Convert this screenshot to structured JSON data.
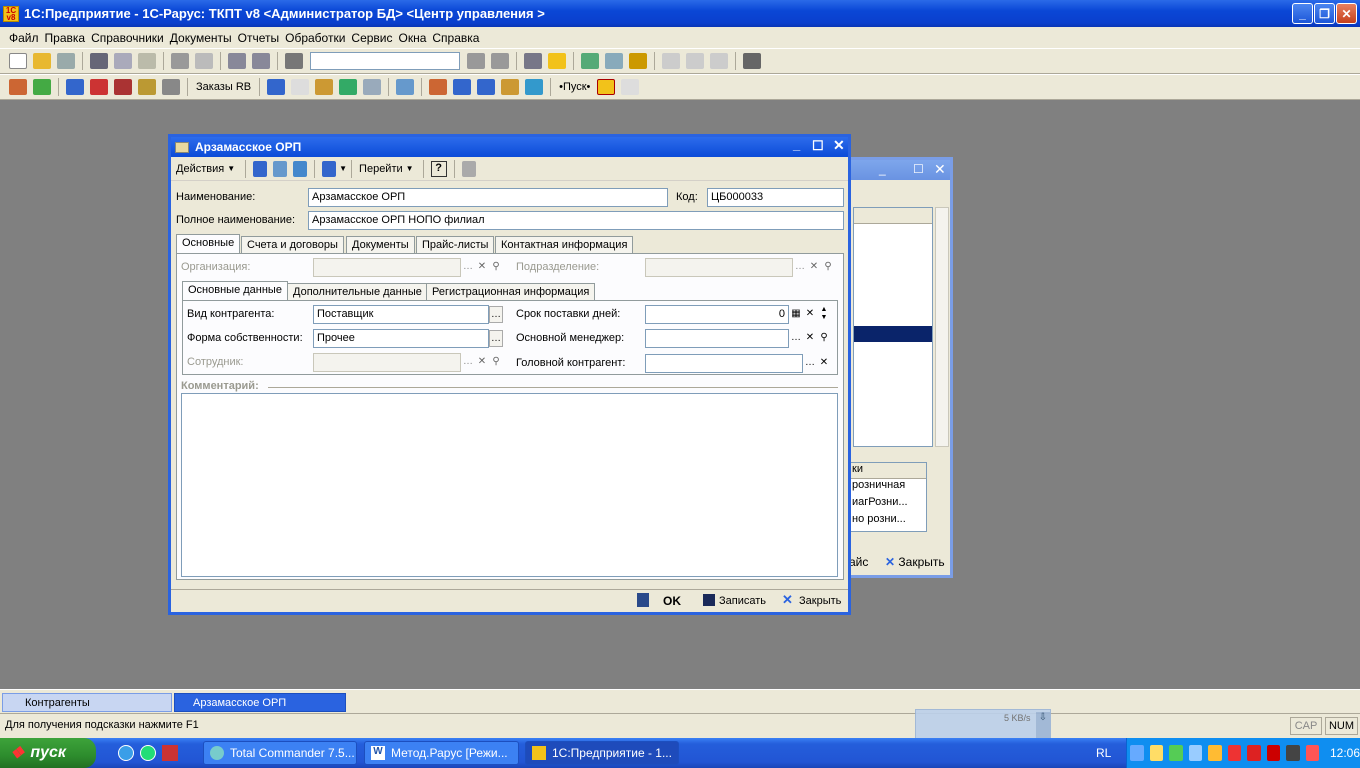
{
  "app": {
    "title": "1С:Предприятие - 1С-Рарус: ТКПТ v8 <Администратор БД> <Центр управления >",
    "logo": "1С v8"
  },
  "menu": [
    "Файл",
    "Правка",
    "Справочники",
    "Документы",
    "Отчеты",
    "Обработки",
    "Сервис",
    "Окна",
    "Справка"
  ],
  "toolbar2": {
    "orders_label": "Заказы RB",
    "start_label": "•Пуск•"
  },
  "dialog": {
    "title": "Арзамасское ОРП",
    "actions_label": "Действия",
    "goto_label": "Перейти",
    "name_label": "Наименование:",
    "name_value": "Арзамасское ОРП",
    "code_label": "Код:",
    "code_value": "ЦБ000033",
    "fullname_label": "Полное наименование:",
    "fullname_value": "Арзамасское ОРП НОПО филиал",
    "tabs": [
      "Основные",
      "Счета и договоры",
      "Документы",
      "Прайс-листы",
      "Контактная информация"
    ],
    "org_label": "Организация:",
    "dept_label": "Подразделение:",
    "subtabs": [
      "Основные данные",
      "Дополнительные данные",
      "Регистрационная информация"
    ],
    "kind_label": "Вид контрагента:",
    "kind_value": "Поставщик",
    "form_label": "Форма собственности:",
    "form_value": "Прочее",
    "employee_label": "Сотрудник:",
    "days_label": "Срок поставки дней:",
    "days_value": "0",
    "manager_label": "Основной менеджер:",
    "head_label": "Головной контрагент:",
    "comment_label": "Комментарий:",
    "ok_label": "OK",
    "save_label": "Записать",
    "close_label": "Закрыть"
  },
  "bgwin": {
    "items": [
      "розничная",
      "иагРозни...",
      "но розни..."
    ],
    "col": "ки",
    "btn1": "айс",
    "close_label": "Закрыть"
  },
  "windowbar": {
    "tab1": "Контрагенты",
    "tab2": "Арзамасское ОРП"
  },
  "status": {
    "hint": "Для получения подсказки нажмите F1",
    "cap": "CAP",
    "num": "NUM"
  },
  "net": {
    "speed": "5 KB/s"
  },
  "taskbar": {
    "start": "пуск",
    "tasks": [
      "Total Commander 7.5...",
      "Метод.Рарус [Режи...",
      "1С:Предприятие - 1..."
    ],
    "lang": "RL",
    "clock": "12:06"
  },
  "colors": {
    "xp_blue": "#2a63e0",
    "selected": "#0a246a"
  }
}
